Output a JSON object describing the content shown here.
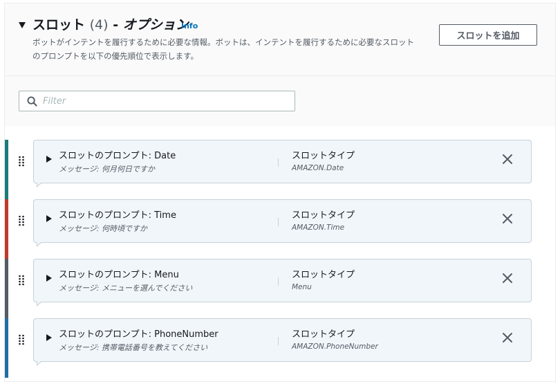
{
  "header": {
    "title": "スロット",
    "count": "(4)",
    "separator": "-",
    "optional": "オプション",
    "info": "Info",
    "description": "ボットがインテントを履行するために必要な情報。ボットは、インテントを履行するために必要なスロットのプロンプトを以下の優先順位で表示します。",
    "add_button": "スロットを追加"
  },
  "filter": {
    "placeholder": "Filter"
  },
  "slots": [
    {
      "prompt": "スロットのプロンプト: Date",
      "message": "メッセージ: 何月何日ですか",
      "type_label": "スロットタイプ",
      "type_value": "AMAZON.Date",
      "color": "#1d7b7b"
    },
    {
      "prompt": "スロットのプロンプト: Time",
      "message": "メッセージ: 何時頃ですか",
      "type_label": "スロットタイプ",
      "type_value": "AMAZON.Time",
      "color": "#c0392b"
    },
    {
      "prompt": "スロットのプロンプト: Menu",
      "message": "メッセージ: メニューを選んでください",
      "type_label": "スロットタイプ",
      "type_value": "Menu",
      "color": "#545b64"
    },
    {
      "prompt": "スロットのプロンプト: PhoneNumber",
      "message": "メッセージ: 携帯電話番号を教えてください",
      "type_label": "スロットタイプ",
      "type_value": "AMAZON.PhoneNumber",
      "color": "#1f6fa6"
    }
  ],
  "colors": {
    "link": "#0073bb",
    "card_bg": "#f1f6fa",
    "card_border": "#c6d1d9"
  }
}
